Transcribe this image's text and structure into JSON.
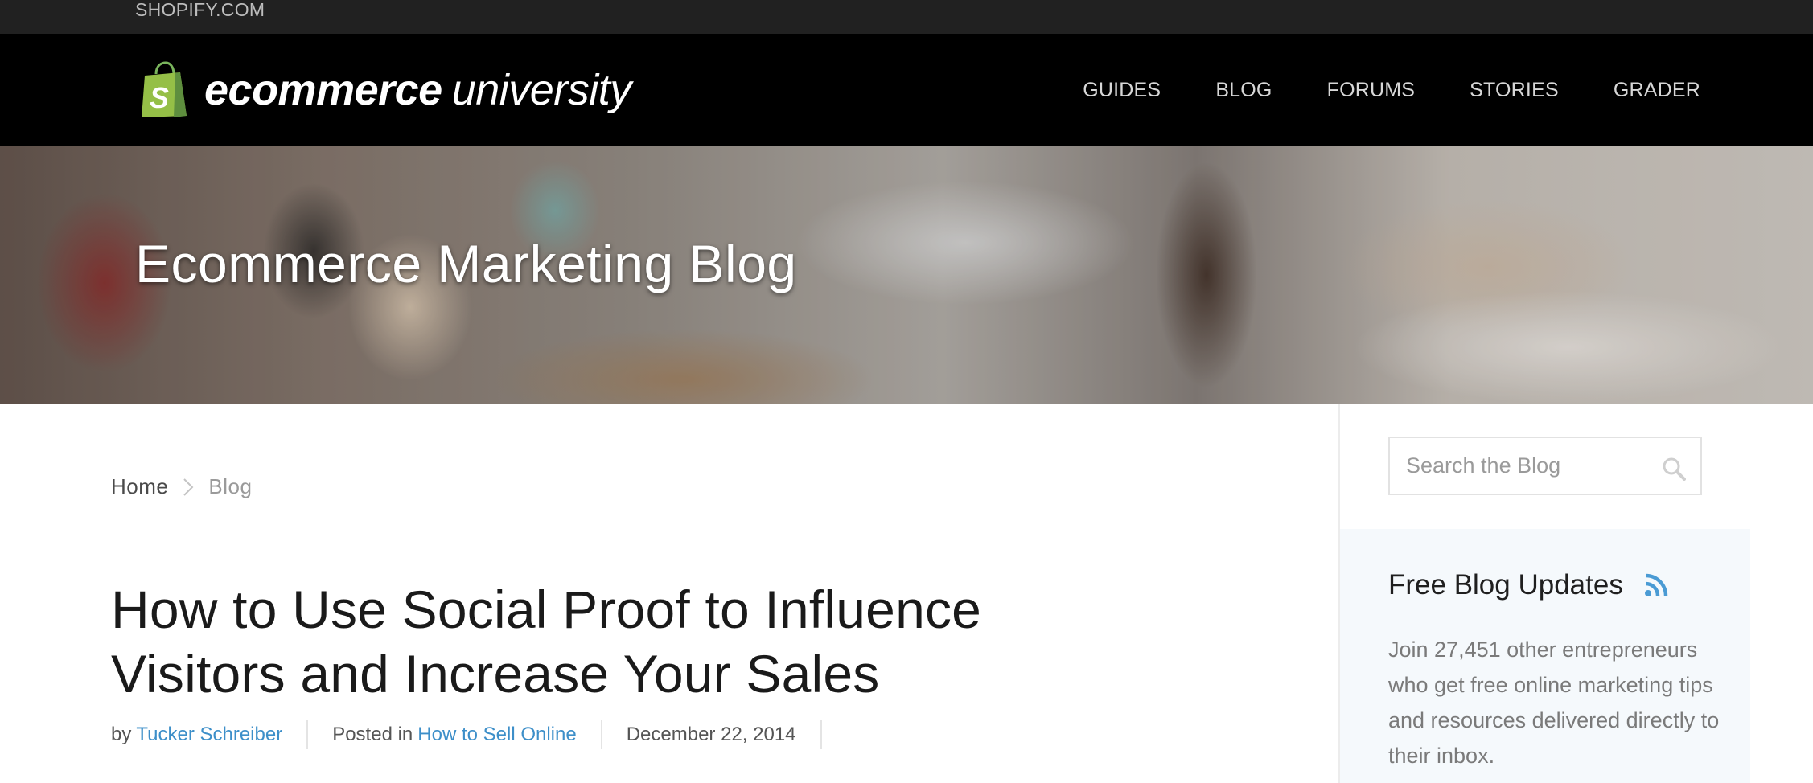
{
  "topbar": {
    "link_label": "SHOPIFY.COM"
  },
  "header": {
    "logo": {
      "bold_text": "ecommerce",
      "light_text": "university",
      "icon": "shopify-bag-icon",
      "bag_color": "#95bf47"
    },
    "nav": [
      {
        "label": "GUIDES"
      },
      {
        "label": "BLOG"
      },
      {
        "label": "FORUMS"
      },
      {
        "label": "STORIES"
      },
      {
        "label": "GRADER"
      }
    ]
  },
  "hero": {
    "title": "Ecommerce Marketing Blog"
  },
  "breadcrumb": {
    "home": "Home",
    "current": "Blog",
    "separator_icon": "chevron-right-icon"
  },
  "article": {
    "title": "How to Use Social Proof to Influence Visitors and Increase Your Sales",
    "meta": {
      "by_prefix": "by",
      "author": "Tucker Schreiber",
      "posted_prefix": "Posted in",
      "category": "How to Sell Online",
      "date": "December 22, 2014"
    }
  },
  "sidebar": {
    "search": {
      "placeholder": "Search the Blog",
      "icon": "search-icon"
    },
    "updates": {
      "heading": "Free Blog Updates",
      "icon": "rss-icon",
      "text": "Join 27,451 other entrepreneurs who get free online marketing tips and resources delivered directly to their inbox."
    }
  },
  "colors": {
    "link_blue": "#3d8fc9",
    "header_bg": "#000000",
    "topbar_bg": "#212121",
    "panel_bg": "#f5f9fc"
  }
}
